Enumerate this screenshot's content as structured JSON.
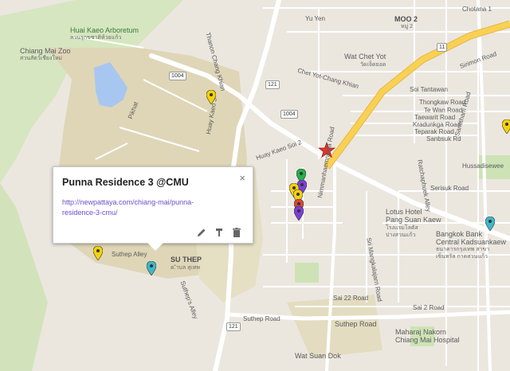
{
  "map": {
    "place_labels": [
      {
        "id": "arboretum",
        "text": "Huai Kaeo Arboretum",
        "thai": "สวนรุกขชาติห้วยแก้ว"
      },
      {
        "id": "zoo",
        "text": "Chiang Mai Zoo",
        "thai": "สวนสัตว์เชียงใหม่"
      },
      {
        "id": "yu-yen",
        "text": "Yu Yen"
      },
      {
        "id": "moo2",
        "text": "MOO 2",
        "thai": "หมู่ 2"
      },
      {
        "id": "chotana",
        "text": "Chotana 1"
      },
      {
        "id": "wat-chet-yot",
        "text": "Wat Chet Yot",
        "thai": "วัดเจ็ดยอด"
      },
      {
        "id": "soi-tantawan",
        "text": "Soi Tantawan"
      },
      {
        "id": "thongkaw",
        "text": "Thongkaw Road"
      },
      {
        "id": "te-wan",
        "text": "Te Wan Road"
      },
      {
        "id": "taewarit",
        "text": "Taewarit Road"
      },
      {
        "id": "kradunkga",
        "text": "Kradunkga Road"
      },
      {
        "id": "teparak",
        "text": "Teparak Road"
      },
      {
        "id": "sanbsuk",
        "text": "Sanbsuk Rd"
      },
      {
        "id": "sirimon",
        "text": "Sirimon Road"
      },
      {
        "id": "santitham",
        "text": "Santitham Road"
      },
      {
        "id": "chet-yot-chang-khian",
        "text": "Chet Yot-Chang Khian"
      },
      {
        "id": "huay-kaeo-soi2",
        "text": "Huay Kaeo Soi 2"
      },
      {
        "id": "huay-kaeo-3",
        "text": "Huay Kaeo 3"
      },
      {
        "id": "thanon-chang-khian",
        "text": "Thanon Chang Khian"
      },
      {
        "id": "pikhat",
        "text": "Pikhat"
      },
      {
        "id": "ratchaphuek",
        "text": "Ratchaphuek Alley"
      },
      {
        "id": "serisuk",
        "text": "Serisuk Road"
      },
      {
        "id": "hussadisewee",
        "text": "Hussadisewee"
      },
      {
        "id": "lotus",
        "text": "Lotus Hotel",
        "text2": "Pang Suan Kaew",
        "thai": "โรงแรมโลตัส",
        "thai2": "ปางสวนแก้ว"
      },
      {
        "id": "bangkok-bank",
        "text": "Bangkok Bank",
        "text2": "Central Kadsuankaew",
        "thai": "ธนาคารกรุงเทพ สาขา",
        "thai2": "เซ็นทรัล กาดสวนแก้ว"
      },
      {
        "id": "nimmanhaemin",
        "text": "Nimmanhaemninda Road"
      },
      {
        "id": "sri-mangkalajarn",
        "text": "Sri Mangkalajarn Road"
      },
      {
        "id": "soi22",
        "text": "Sai 22 Road"
      },
      {
        "id": "soi2",
        "text": "Sai 2 Road"
      },
      {
        "id": "su-thep",
        "text": "SU THEP",
        "thai": "ต.ำบล สุเทพ"
      },
      {
        "id": "suthep-alley",
        "text": "Suthep Alley"
      },
      {
        "id": "suthep-5-alley",
        "text": "Suthep's Alley"
      },
      {
        "id": "suthep-road-left",
        "text": "Suthep Road"
      },
      {
        "id": "suthep-road-right",
        "text": "Suthep Road"
      },
      {
        "id": "maharaj",
        "text": "Maharaj Nakorn",
        "text2": "Chiang Mai Hospital"
      },
      {
        "id": "wat-suan-dok",
        "text": "Wat Suan Dok"
      }
    ],
    "shields": [
      {
        "id": "s1004a",
        "text": "1004"
      },
      {
        "id": "s1004b",
        "text": "1004"
      },
      {
        "id": "s121a",
        "text": "121"
      },
      {
        "id": "s121b",
        "text": "121"
      },
      {
        "id": "s11",
        "text": "11"
      }
    ],
    "markers": [
      {
        "id": "m1",
        "color": "#f5d20b"
      },
      {
        "id": "m2",
        "color": "#22b14c"
      },
      {
        "id": "m3",
        "color": "#7a3fd6"
      },
      {
        "id": "m4",
        "color": "#f5d20b"
      },
      {
        "id": "m5",
        "color": "#f5d20b"
      },
      {
        "id": "m6",
        "color": "#d9473c"
      },
      {
        "id": "m7",
        "color": "#7a3fd6"
      },
      {
        "id": "m8",
        "color": "#f5d20b"
      },
      {
        "id": "m9",
        "color": "#3fb8c9"
      },
      {
        "id": "m10",
        "color": "#3fb8c9"
      },
      {
        "id": "m11",
        "color": "#f5d20b"
      }
    ],
    "star_color": "#e0362c",
    "colors": {
      "background": "#ebe7df",
      "park": "#cde3b6",
      "water": "#a8c7f0",
      "campus": "#dfd6b8",
      "highway": "#f8d154",
      "road": "#ffffff"
    }
  },
  "popup": {
    "title": "Punna Residence 3 @CMU",
    "link": "http://newpattaya.com/chiang-mai/punna-residence-3-cmu/",
    "close_label": "×"
  }
}
